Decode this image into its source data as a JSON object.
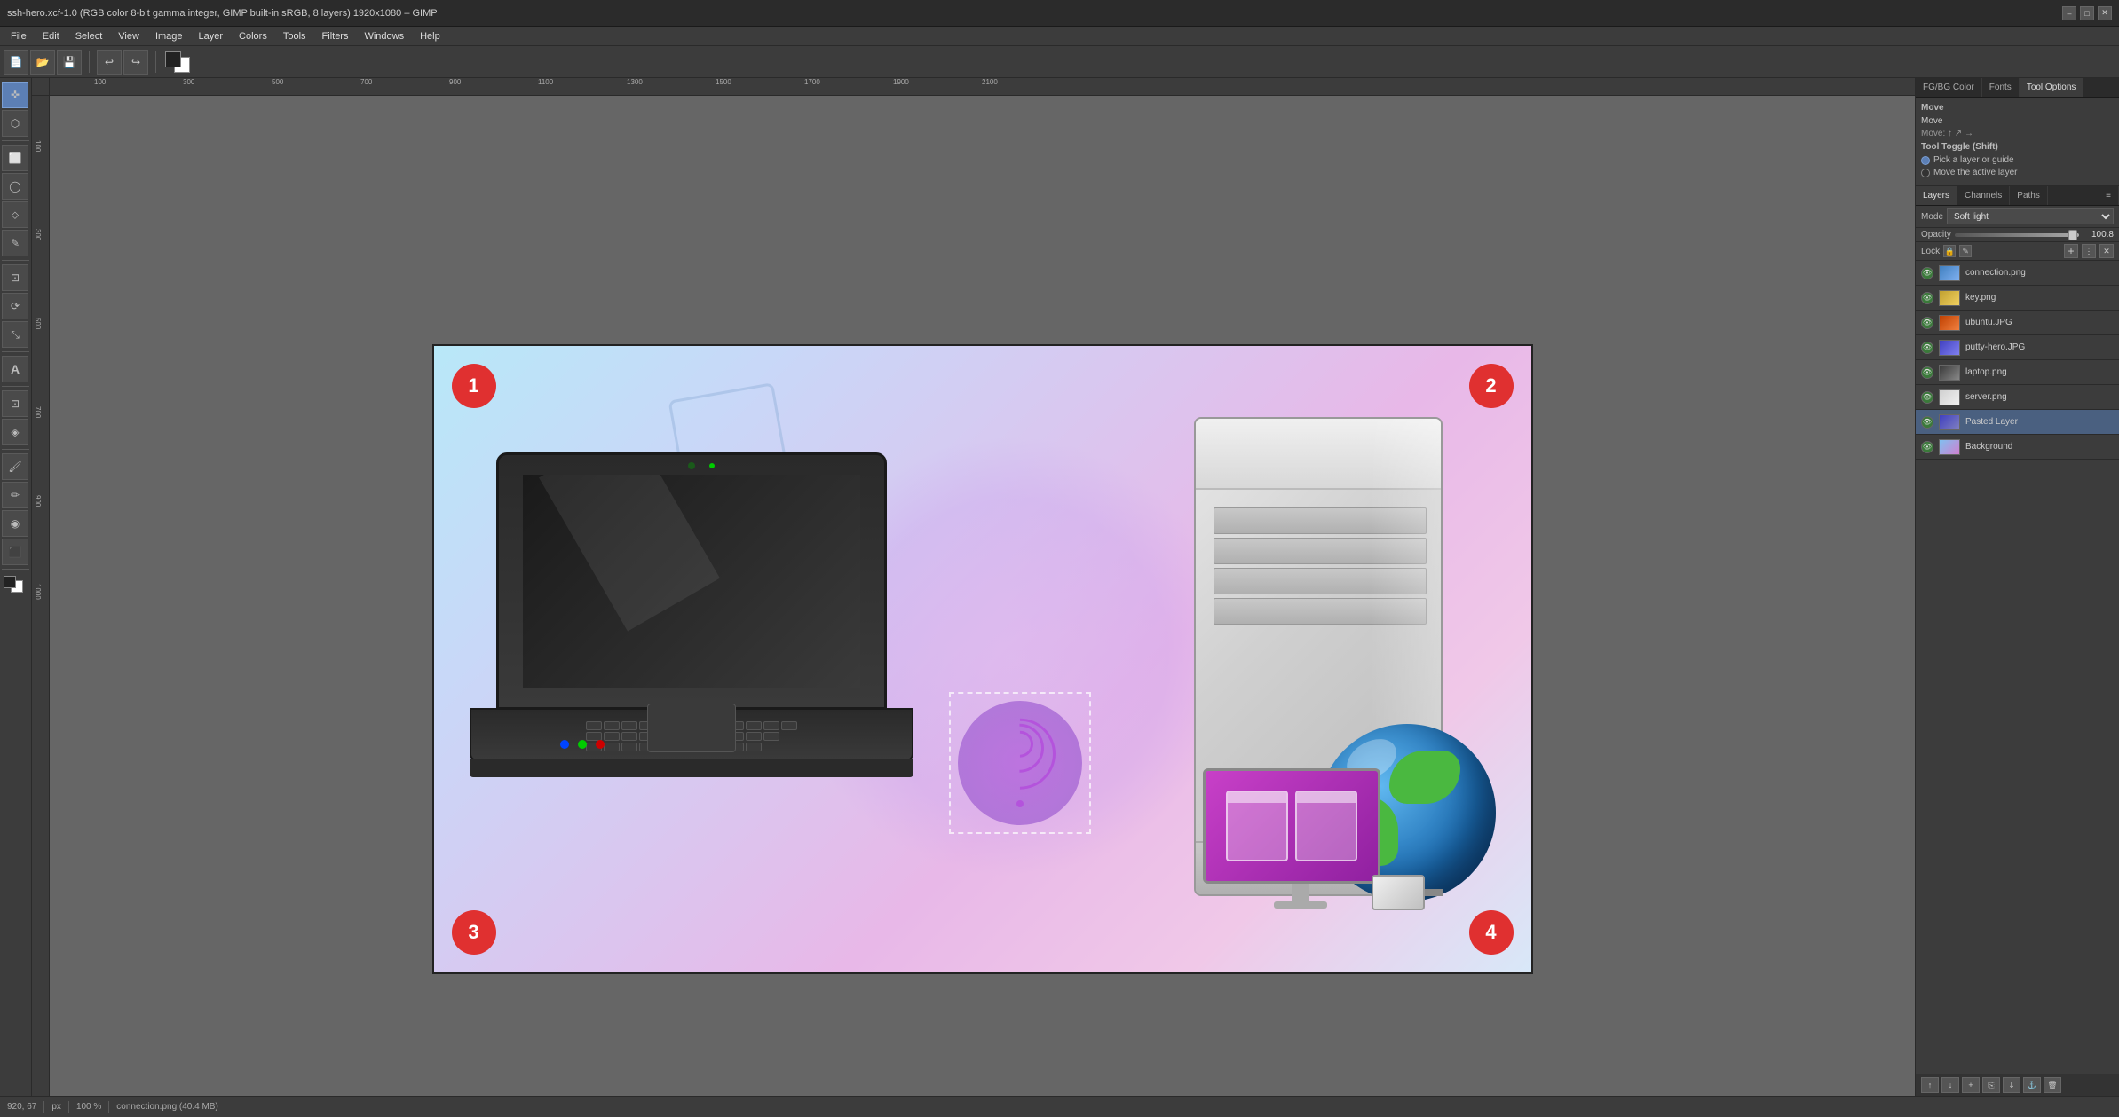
{
  "window": {
    "title": "ssh-hero.xcf-1.0 (RGB color 8-bit gamma integer, GIMP built-in sRGB, 8 layers) 1920x1080 – GIMP",
    "minimize_label": "–",
    "maximize_label": "□",
    "close_label": "✕"
  },
  "menu": {
    "items": [
      "File",
      "Edit",
      "Select",
      "View",
      "Image",
      "Layer",
      "Colors",
      "Tools",
      "Filters",
      "Windows",
      "Help"
    ]
  },
  "toolbar": {
    "fg_bg_label": "FG/BG"
  },
  "tools": {
    "list": [
      "✜",
      "⬡",
      "⬜",
      "◈",
      "⬦",
      "✎",
      "🖌",
      "✒",
      "🖋",
      "⌨",
      "A",
      "⬡",
      "⬡",
      "◉",
      "⟳",
      "⬡",
      "⬛",
      "▣",
      "⬡",
      "⬡",
      "⬡",
      "▲",
      "⬡",
      "⬡",
      "◧",
      "⬡",
      "⬡"
    ]
  },
  "right_panel": {
    "tabs": [
      "FG/BG Color",
      "Fonts",
      "Tool Options"
    ],
    "active_tab": "Tool Options"
  },
  "tool_options": {
    "section_title": "Move",
    "subsection_title": "Move",
    "tool_toggle_label": "Tool Toggle (Shift)",
    "option1_label": "Pick a layer or guide",
    "option2_label": "Move the active layer",
    "option1_checked": true,
    "option2_checked": false
  },
  "layers_panel": {
    "tabs": [
      "Layers",
      "Channels",
      "Paths"
    ],
    "active_tab": "Layers",
    "mode_label": "Mode",
    "mode_value": "Soft light",
    "opacity_label": "Opacity",
    "opacity_value": "100.8",
    "lock_label": "Lock",
    "layers": [
      {
        "name": "connection.png",
        "visible": true,
        "active": false,
        "thumb_class": "lt-connection"
      },
      {
        "name": "key.png",
        "visible": true,
        "active": false,
        "thumb_class": "lt-key"
      },
      {
        "name": "ubuntu.JPG",
        "visible": true,
        "active": false,
        "thumb_class": "lt-ubuntu"
      },
      {
        "name": "putty-hero.JPG",
        "visible": true,
        "active": false,
        "thumb_class": "lt-putty"
      },
      {
        "name": "laptop.png",
        "visible": true,
        "active": false,
        "thumb_class": "lt-laptop"
      },
      {
        "name": "server.png",
        "visible": true,
        "active": false,
        "thumb_class": "lt-server"
      },
      {
        "name": "Pasted Layer",
        "visible": true,
        "active": true,
        "thumb_class": "lt-pasted"
      },
      {
        "name": "Background",
        "visible": true,
        "active": false,
        "thumb_class": "lt-background"
      }
    ]
  },
  "status_bar": {
    "coordinate": "920, 67",
    "unit": "px",
    "zoom": "100 %",
    "file_info": "connection.png (40.4 MB)"
  },
  "number_markers": {
    "n1": "1",
    "n2": "2",
    "n3": "3",
    "n4": "4"
  }
}
